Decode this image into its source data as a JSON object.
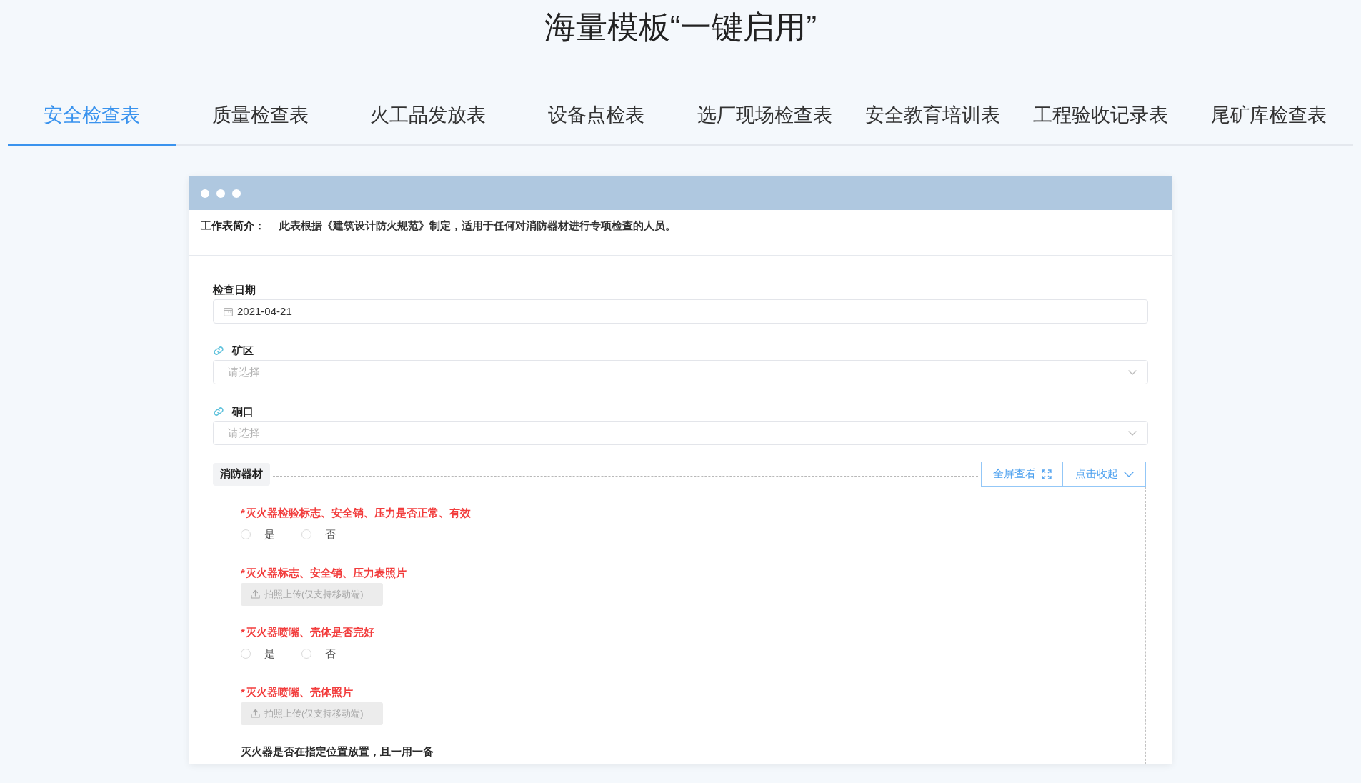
{
  "page_title": "海量模板“一键启用”",
  "tabs": [
    {
      "label": "安全检查表",
      "selected": true
    },
    {
      "label": "质量检查表",
      "selected": false
    },
    {
      "label": "火工品发放表",
      "selected": false
    },
    {
      "label": "设备点检表",
      "selected": false
    },
    {
      "label": "选厂现场检查表",
      "selected": false
    },
    {
      "label": "安全教育培训表",
      "selected": false
    },
    {
      "label": "工程验收记录表",
      "selected": false
    },
    {
      "label": "尾矿库检查表",
      "selected": false
    }
  ],
  "window": {
    "intro": {
      "label": "工作表简介：",
      "text": "此表根据《建筑设计防火规范》制定，适用于任何对消防器材进行专项检查的人员。"
    },
    "fields": [
      {
        "kind": "date",
        "label": "检查日期",
        "linked": false,
        "value": "2021-04-21"
      },
      {
        "kind": "select",
        "label": "矿区",
        "linked": true,
        "placeholder": "请选择"
      },
      {
        "kind": "select",
        "label": "硐口",
        "linked": true,
        "placeholder": "请选择"
      }
    ],
    "section": {
      "title": "消防器材",
      "buttons": [
        {
          "kind": "fullscreen",
          "label": "全屏查看"
        },
        {
          "kind": "collapse",
          "label": "点击收起"
        }
      ],
      "items": [
        {
          "kind": "radio",
          "required": true,
          "mark": "*",
          "label": "灭火器检验标志、安全销、压力是否正常、有效",
          "options": [
            {
              "label": "是",
              "selected": false
            },
            {
              "label": "否",
              "selected": false
            }
          ]
        },
        {
          "kind": "upload",
          "required": true,
          "mark": "*",
          "label": "灭火器标志、安全销、压力表照片",
          "button": {
            "label": "拍照上传(仅支持移动端)",
            "disabled": true
          }
        },
        {
          "kind": "radio",
          "required": true,
          "mark": "*",
          "label": "灭火器喷嘴、壳体是否完好",
          "options": [
            {
              "label": "是",
              "selected": false
            },
            {
              "label": "否",
              "selected": false
            }
          ]
        },
        {
          "kind": "upload",
          "required": true,
          "mark": "*",
          "label": "灭火器喷嘴、壳体照片",
          "button": {
            "label": "拍照上传(仅支持移动端)",
            "disabled": true
          }
        },
        {
          "kind": "radio",
          "required": false,
          "label": "灭火器是否在指定位置放置，且一用一备"
        }
      ]
    }
  }
}
